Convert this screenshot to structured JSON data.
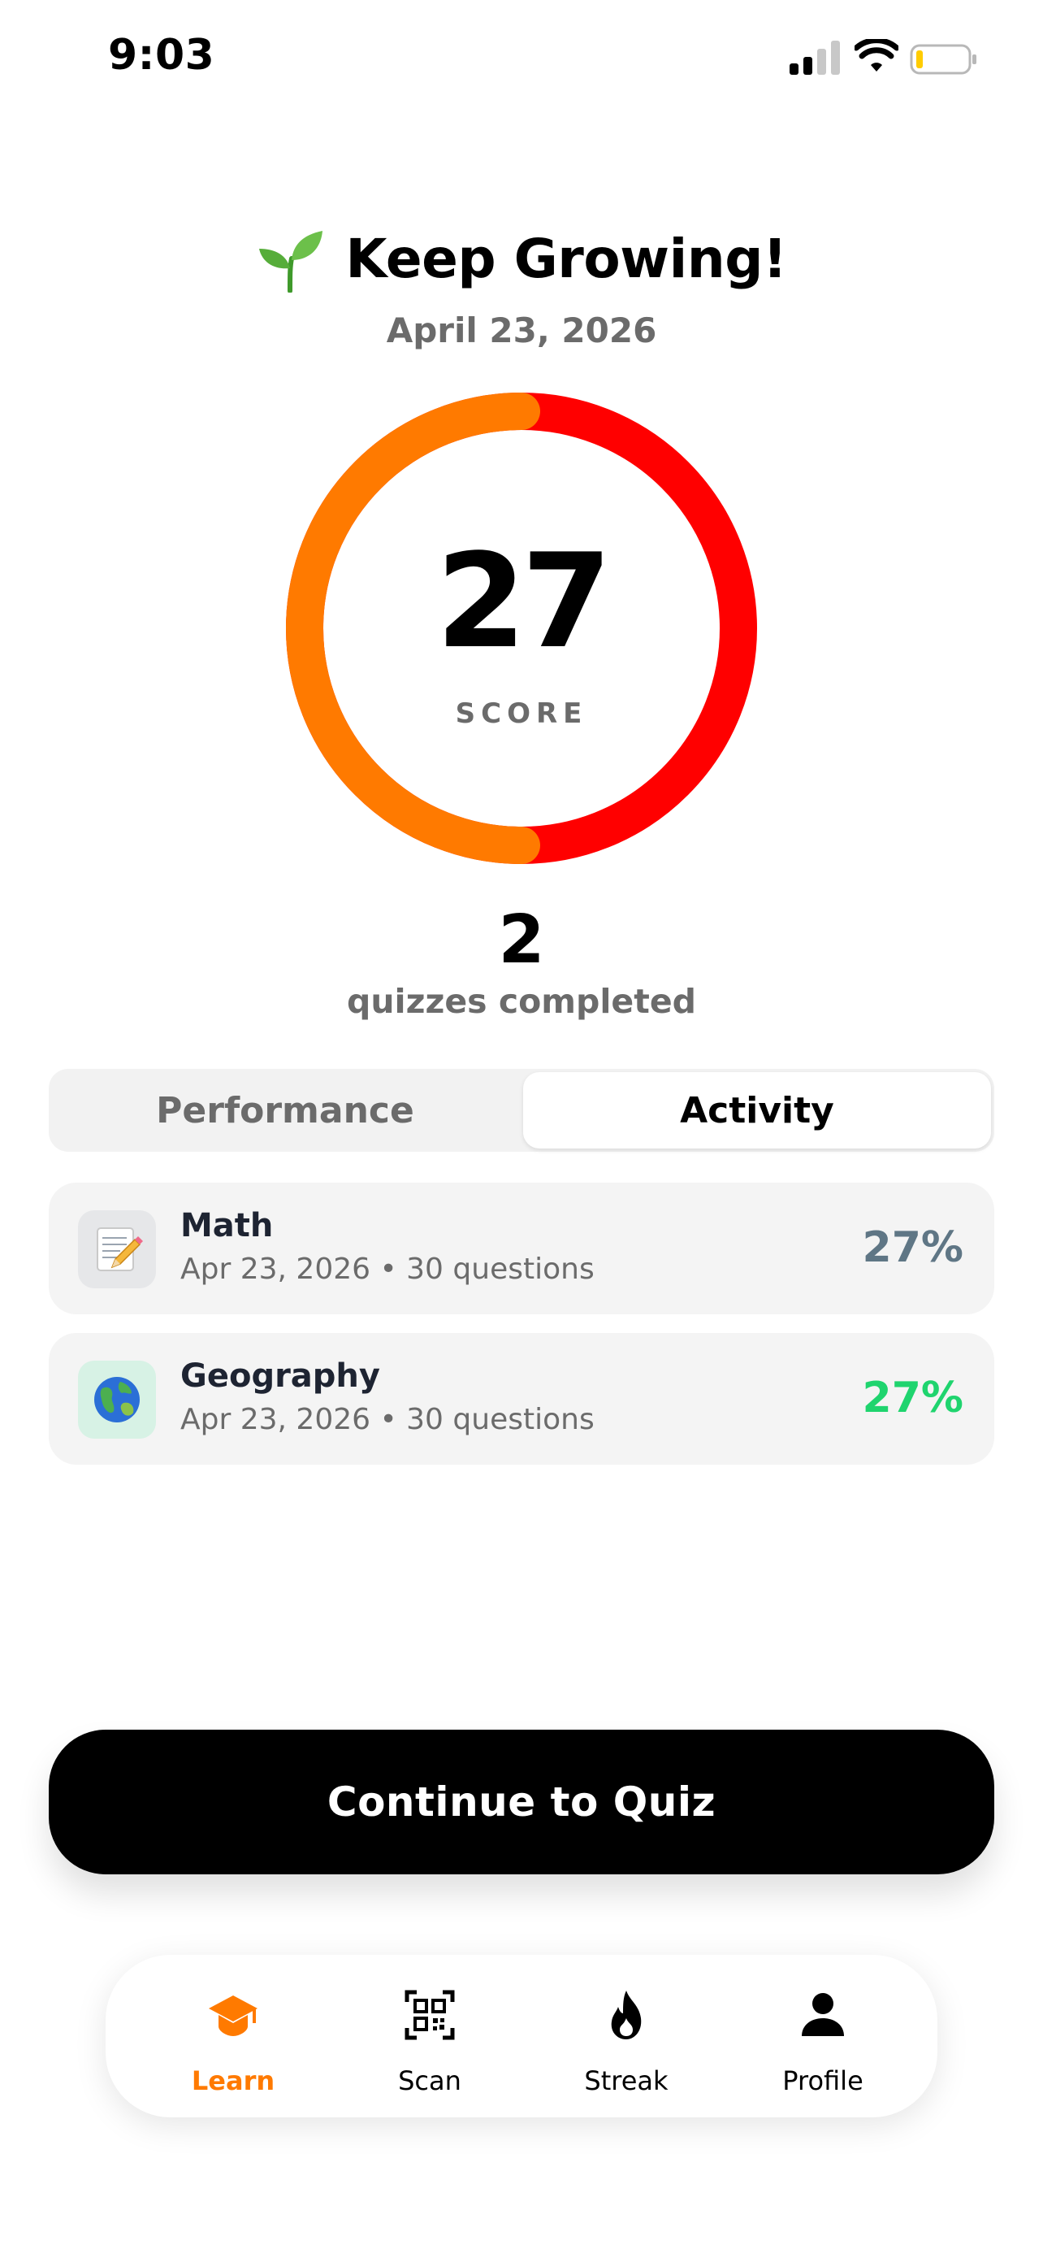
{
  "status_bar": {
    "time": "9:03"
  },
  "header": {
    "title": "Keep Growing!",
    "date": "April 23, 2026",
    "icon": "sprout-icon"
  },
  "score": {
    "value": "27",
    "label": "SCORE",
    "percent": 27,
    "colors": [
      "#ff7a00",
      "#ff0000"
    ]
  },
  "completed": {
    "count": "2",
    "label": "quizzes completed"
  },
  "tabs": {
    "performance": "Performance",
    "activity": "Activity",
    "selected": "Activity"
  },
  "quizzes": [
    {
      "name": "Math",
      "meta": "Apr 23, 2026 • 30 questions",
      "percent": "27%",
      "icon": "memo-icon",
      "color": "#5f7685"
    },
    {
      "name": "Geography",
      "meta": "Apr 23, 2026 • 30 questions",
      "percent": "27%",
      "icon": "globe-icon",
      "color": "#1fd46e"
    }
  ],
  "cta": {
    "label": "Continue to Quiz"
  },
  "nav": {
    "learn": "Learn",
    "scan": "Scan",
    "streak": "Streak",
    "profile": "Profile",
    "active": "Learn",
    "accent": "#ff7a00"
  }
}
